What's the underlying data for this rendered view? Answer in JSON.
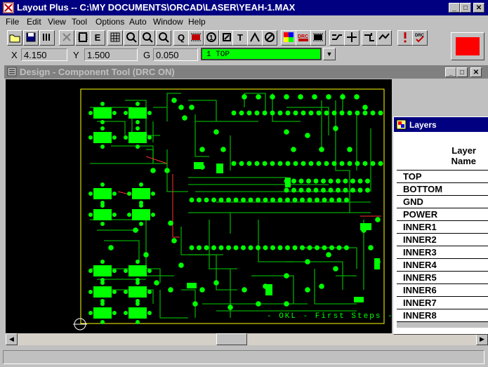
{
  "app": {
    "title": "Layout Plus -- C:\\MY DOCUMENTS\\ORCAD\\LASER\\YEAH-1.MAX"
  },
  "menu": [
    "File",
    "Edit",
    "View",
    "Tool",
    "Options",
    "Auto",
    "Window",
    "Help"
  ],
  "toolbar": {
    "buttons": [
      "open-folder",
      "save",
      "print",
      "cut",
      "component",
      "grid",
      "zoom-in",
      "zoom-out",
      "zoom-fit",
      "query",
      "footprint",
      "pin",
      "obstacle",
      "text",
      "connection",
      "error",
      "color",
      "drc",
      "reconnect",
      "route",
      "edit-segment",
      "shove",
      "online-drc",
      "design-rule-check",
      "drc-check"
    ]
  },
  "coords": {
    "x_label": "X",
    "x_value": "4.150",
    "y_label": "Y",
    "y_value": "1.500",
    "g_label": "G",
    "g_value": "0.050",
    "active_layer": "1 TOP"
  },
  "colors": {
    "active_layer": "#00ff00",
    "swatch": "#ff0000",
    "title_active": "#000080",
    "title_inactive": "#808080",
    "board_outline": "#ffff00",
    "pad": "#00ff00",
    "trace": "#00aa00"
  },
  "design_window": {
    "title": "Design - Component Tool (DRC ON)",
    "board_text": "- OKL - First Steps -"
  },
  "layers_panel": {
    "title": "Layers",
    "header_line1": "Layer",
    "header_line2": "Name",
    "rows": [
      "TOP",
      "BOTTOM",
      "GND",
      "POWER",
      "INNER1",
      "INNER2",
      "INNER3",
      "INNER4",
      "INNER5",
      "INNER6",
      "INNER7",
      "INNER8"
    ]
  }
}
